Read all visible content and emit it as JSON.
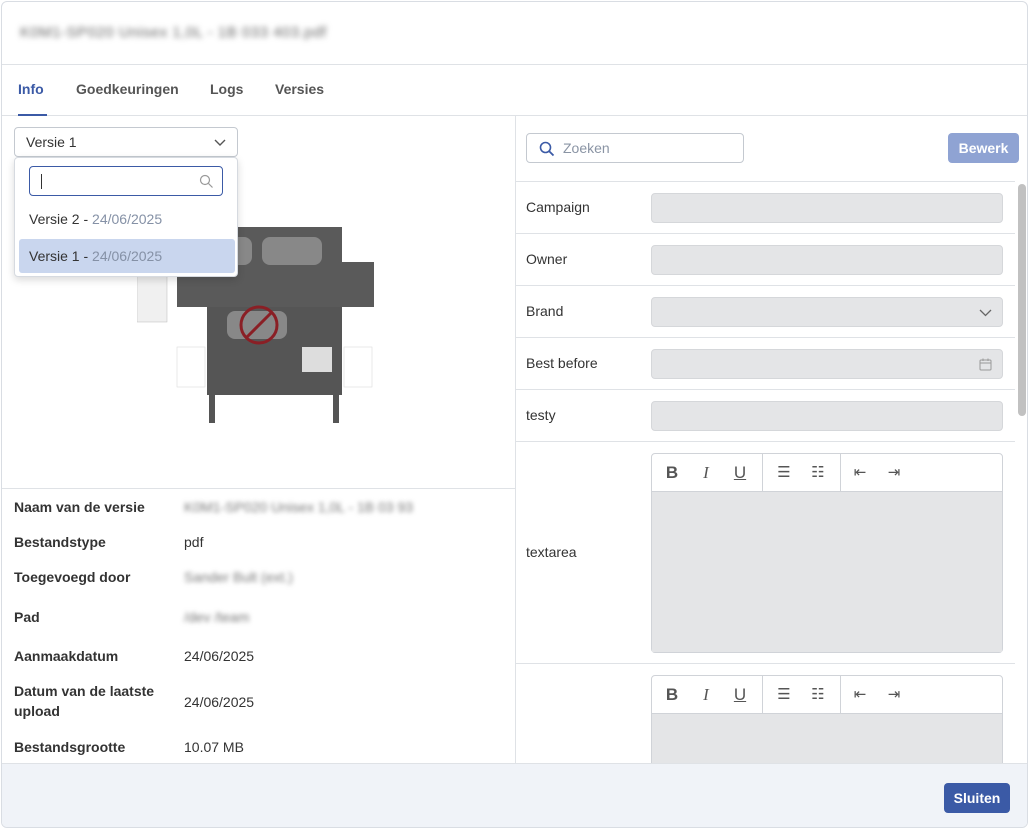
{
  "header": {
    "title": "K0M1-SP020 Unisex 1,0L - 1B 033 403.pdf"
  },
  "tabs": [
    {
      "label": "Info"
    },
    {
      "label": "Goedkeuringen"
    },
    {
      "label": "Logs"
    },
    {
      "label": "Versies"
    }
  ],
  "version_select": {
    "value": "Versie 1",
    "options": [
      {
        "label": "Versie 2 - ",
        "date": "24/06/2025"
      },
      {
        "label": "Versie 1 - ",
        "date": "24/06/2025"
      }
    ]
  },
  "metadata": [
    {
      "label": "Naam van de versie",
      "value": "K0M1-SP020 Unisex 1,0L - 1B 03 93"
    },
    {
      "label": "Bestandstype",
      "value": "pdf"
    },
    {
      "label": "Toegevoegd door",
      "value": "Sander Bult (ext.)"
    },
    {
      "label": "Pad",
      "value": "/dev /team"
    },
    {
      "label": "Aanmaakdatum",
      "value": "24/06/2025"
    },
    {
      "label": "Datum van de laatste upload",
      "value": "24/06/2025"
    },
    {
      "label": "Bestandsgrootte",
      "value": "10.07 MB"
    }
  ],
  "search": {
    "placeholder": "Zoeken"
  },
  "edit_button": "Bewerk",
  "fields": [
    {
      "label": "Campaign"
    },
    {
      "label": "Owner"
    },
    {
      "label": "Brand"
    },
    {
      "label": "Best before"
    },
    {
      "label": "testy"
    },
    {
      "label": "textarea"
    },
    {
      "label": ""
    }
  ],
  "footer": {
    "close_label": "Sluiten"
  }
}
